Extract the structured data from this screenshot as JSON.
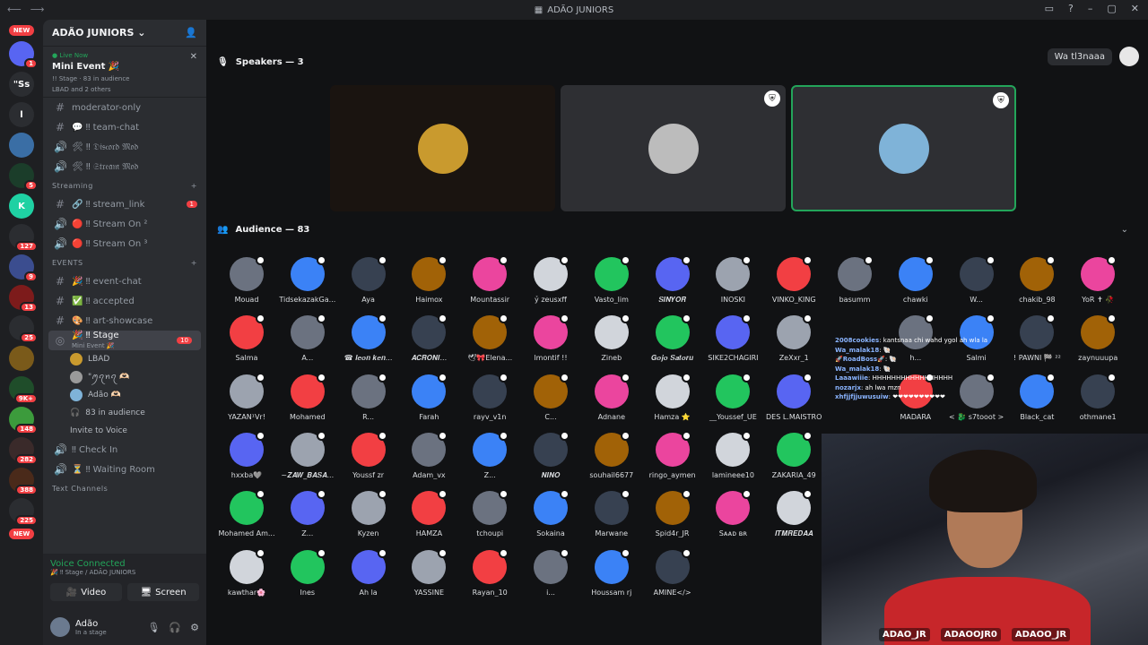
{
  "titlebar": {
    "title": "ADÃO JUNIORS"
  },
  "servers": {
    "new_top": "NEW",
    "new_bottom": "NEW",
    "items": [
      {
        "color": "#5865f2",
        "label": "",
        "badge": "1"
      },
      {
        "color": "#2b2d31",
        "label": "\"Ss",
        "badge": ""
      },
      {
        "color": "#2b2d31",
        "label": "l",
        "badge": ""
      },
      {
        "color": "#3a6ea5",
        "label": "",
        "badge": ""
      },
      {
        "color": "#1b3d2a",
        "label": "",
        "badge": "5"
      },
      {
        "color": "#1fd1a3",
        "label": "K",
        "badge": ""
      },
      {
        "color": "#2b2d31",
        "label": "",
        "badge": "127"
      },
      {
        "color": "#3b4d8f",
        "label": "",
        "badge": "9"
      },
      {
        "color": "#7d1b1b",
        "label": "",
        "badge": "13"
      },
      {
        "color": "#2b2d31",
        "label": "",
        "badge": "25"
      },
      {
        "color": "#7a5a1a",
        "label": "",
        "badge": ""
      },
      {
        "color": "#1f4d2a",
        "label": "",
        "badge": "9K+"
      },
      {
        "color": "#3c9b3c",
        "label": "",
        "badge": "148"
      },
      {
        "color": "#3a2a2a",
        "label": "",
        "badge": "282"
      },
      {
        "color": "#4a2a1a",
        "label": "",
        "badge": "388"
      },
      {
        "color": "#2b2d31",
        "label": "",
        "badge": "225"
      }
    ]
  },
  "sidebar": {
    "guild_name": "ADÃO JUNIORS",
    "live": {
      "status": "Live Now",
      "event": "Mini Event 🎉",
      "stage": "!! Stage · 83 in audience",
      "hosts": "LBAD and 2 others"
    },
    "channels_top": [
      {
        "icon": "#",
        "name": "moderator-only"
      },
      {
        "icon": "#",
        "name": "💬 ‼ team-chat"
      },
      {
        "icon": "🔊",
        "name": "🛠 ‼ 𝔇𝔦𝔰𝔠𝔬𝔯𝔡 𝔐𝔬𝔡"
      },
      {
        "icon": "🔊",
        "name": "🛠 ‼ 𝔖𝔱𝔯𝔢𝔞𝔪 𝔐𝔬𝔡"
      }
    ],
    "cat_streaming": "Streaming",
    "channels_streaming": [
      {
        "icon": "#",
        "name": "🔗 ‼ stream_link",
        "count": "1"
      },
      {
        "icon": "🔊",
        "name": "🔴 ‼ Stream On ²",
        "count": ""
      },
      {
        "icon": "🔊",
        "name": "🔴 ‼ Stream On ³",
        "count": ""
      }
    ],
    "cat_events": "EVENTS",
    "channels_events": [
      {
        "icon": "#",
        "name": "🎉 ‼ event-chat"
      },
      {
        "icon": "#",
        "name": "✅ ‼ accepted"
      },
      {
        "icon": "#",
        "name": "🎨 ‼ art-showcase"
      }
    ],
    "stage_channel": {
      "name": "🎉 ‼ Stage",
      "sub": "Mini Event 🎉",
      "count": "10"
    },
    "stage_users": [
      "LBAD",
      "\"ꪑꪖꪀꪖ 🫶🏻",
      "Adão 🫶🏻"
    ],
    "stage_audience": "83 in audience",
    "invite": "Invite to Voice",
    "channels_bottom": [
      {
        "icon": "🔊",
        "name": "‼ Check In"
      },
      {
        "icon": "🔊",
        "name": "⏳ ‼ Waiting Room"
      }
    ],
    "cat_text": "Text Channels",
    "voice_panel": {
      "title": "Voice Connected",
      "sub": "🎉 ‼ Stage / ADÃO JUNIORS",
      "video": "Video",
      "screen": "Screen"
    },
    "user": {
      "name": "Adão",
      "status": "In a stage"
    }
  },
  "main": {
    "speakers_header": "Speakers — 3",
    "audience_header": "Audience — 83",
    "topright_pill": "Wa tl3naaa",
    "speakers": [
      {
        "bg": "#1a1410",
        "avatar": "#c99a2e",
        "mod": false,
        "selected": false
      },
      {
        "bg": "#2e2f33",
        "avatar": "#bcbcbc",
        "mod": true,
        "selected": false
      },
      {
        "bg": "#2e2f33",
        "avatar": "#7fb3d8",
        "mod": true,
        "selected": true
      }
    ],
    "audience": [
      [
        "Mouad",
        "TidsekazakGa...",
        "Aya",
        "Haimox",
        "Mountassir",
        "ỷ zeusxff",
        "Vasto_lim",
        "𝑺𝑰𝑵𝒀𝑶𝑹",
        "INOSKI",
        "VINKO_KING",
        "basumm",
        "chawki",
        "W...",
        "chakib_98",
        "YoR ✝ 🥀"
      ],
      [
        "Salma",
        "A...",
        "☎ 𝒍𝒆𝒐𝒏 𝒌𝒆𝒏...",
        "𝑨𝑪𝑹𝑶𝑵𝑰...",
        "🕊🎀Elena...",
        "lmontif !!",
        "Zineb",
        "𝑮𝒐𝒋𝒐 𝑺𝒂𝒕𝒐𝒓𝒖",
        "SIKE2CHAGIRI",
        "ZeXxr_1",
        "",
        "h...",
        "Salmi",
        "! PAWNI 🏁 ²²",
        "zaynuuupa"
      ],
      [
        "YAZAN¹Vr!",
        "Mohamed",
        "R...",
        "Farah",
        "rayv_v1n",
        "C...",
        "Adnane",
        "Hamza ⭐",
        "__Youssef_UE",
        "DES L.MAISTRO",
        "",
        "MADARA",
        "< 🐉 s7tooot >",
        "Black_cat",
        "othmane1"
      ],
      [
        "hxxba🩶",
        "~𝒁𝑨𝑾_𝑩𝑨𝑺𝑨...",
        "Youssf zr",
        "Adam_vx",
        "Z...",
        "𝑵𝑰𝑵𝑶",
        "souhail6677",
        "ringo_aymen",
        "lamineee10",
        "ZAKARIA_49",
        "",
        "",
        "",
        "",
        ""
      ],
      [
        "Mohamed Am...",
        "Z...",
        "Kyzen",
        "HAMZA",
        "tchoupi",
        "Sokaina",
        "Marwane",
        "Spid4r_JR",
        "Sᴀᴀᴅ ʙʀ",
        "𝑰𝑻𝑴𝑹𝑬𝑫𝑨𝑨",
        "",
        "",
        "",
        "",
        ""
      ],
      [
        "kawthar🌸",
        "Ines",
        "Ah la",
        "YASSINE",
        "Rayan_10",
        "i...",
        "Houssam rj",
        "AMINE</>",
        "",
        "",
        "",
        "",
        "",
        "",
        ""
      ]
    ],
    "overlay_chat": [
      {
        "user": "2008cookies",
        "msg": ": kantsnaa chi wahd ygol ah wla la"
      },
      {
        "user": "Wa_malak18",
        "msg": ": 🐚"
      },
      {
        "user": "🚀RoadBoss🚀",
        "msg": ": 🐚"
      },
      {
        "user": "Wa_malak18",
        "msg": ": 🐚"
      },
      {
        "user": "Laaawiiie",
        "msg": ": HHHHHHHHHHHHHHHHH"
      },
      {
        "user": "nozarjx",
        "msg": ": ah lwa mzn"
      },
      {
        "user": "xhfjjfjjuwusuiw",
        "msg": ": ❤❤❤❤❤❤❤❤❤❤"
      }
    ],
    "cam_socials": [
      "ADAO_JR",
      "ADAOOJR0",
      "ADAOO_JR"
    ]
  }
}
